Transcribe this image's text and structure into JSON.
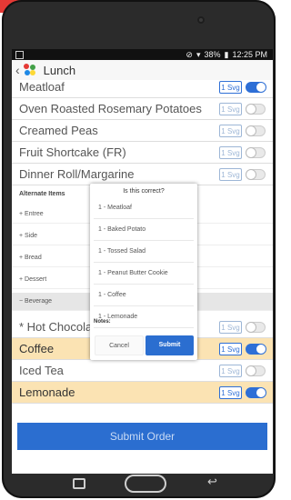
{
  "status": {
    "battery": "38%",
    "time": "12:25 PM"
  },
  "header": {
    "title": "Lunch"
  },
  "menu_items": [
    {
      "name": "Meatloaf",
      "svg": "1 Svg",
      "on": true,
      "highlight": false
    },
    {
      "name": "Oven Roasted Rosemary Potatoes",
      "svg": "1 Svg",
      "on": false,
      "highlight": false
    },
    {
      "name": "Creamed Peas",
      "svg": "1 Svg",
      "on": false,
      "highlight": false
    },
    {
      "name": "Fruit Shortcake (FR)",
      "svg": "1 Svg",
      "on": false,
      "highlight": false
    },
    {
      "name": "Dinner Roll/Margarine",
      "svg": "1 Svg",
      "on": false,
      "highlight": false
    }
  ],
  "alternate": {
    "title": "Alternate Items",
    "groups": [
      "+ Entree",
      "+ Side",
      "+ Bread",
      "+ Dessert",
      "− Beverage"
    ]
  },
  "beverages": [
    {
      "name": "* Hot Chocolate",
      "svg": "1 Svg",
      "on": false,
      "highlight": false
    },
    {
      "name": "Coffee",
      "svg": "1 Svg",
      "on": true,
      "highlight": true
    },
    {
      "name": "Iced Tea",
      "svg": "1 Svg",
      "on": false,
      "highlight": false
    },
    {
      "name": "Lemonade",
      "svg": "1 Svg",
      "on": true,
      "highlight": true
    }
  ],
  "submit_order": "Submit Order",
  "dialog": {
    "title": "Is this correct?",
    "items": [
      "1 - Meatloaf",
      "1 - Baked Potato",
      "1 - Tossed Salad",
      "1 - Peanut Butter Cookie",
      "1 - Coffee",
      "1 - Lemonade"
    ],
    "notes": "Notes:",
    "cancel": "Cancel",
    "submit": "Submit"
  },
  "colors": {
    "accent": "#2b6ed0",
    "highlight": "#fbe3b3"
  }
}
